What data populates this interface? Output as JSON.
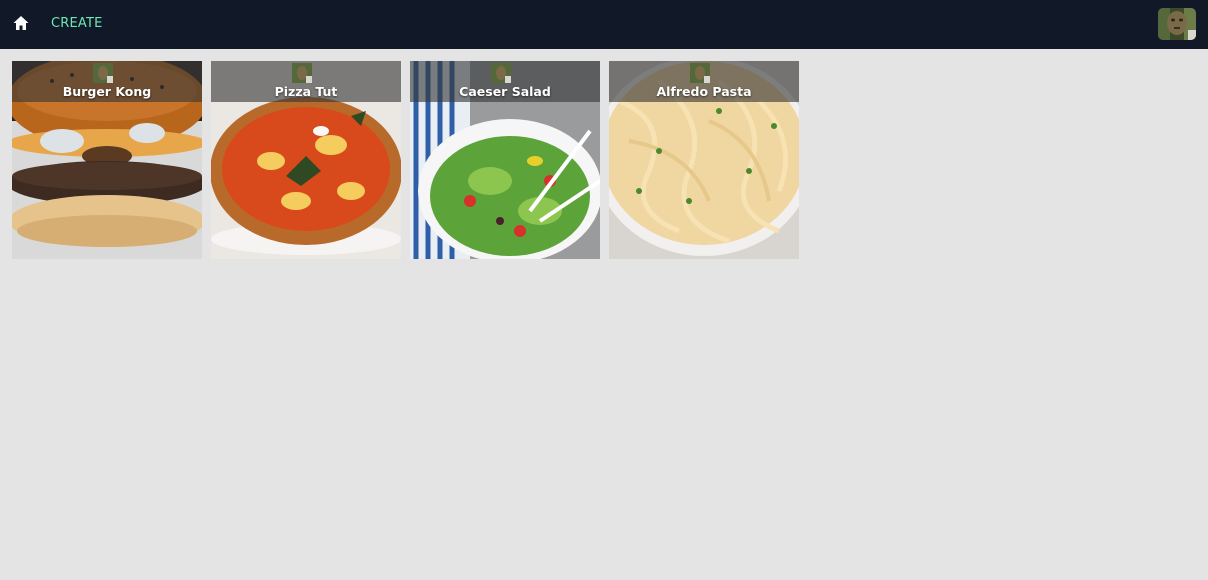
{
  "nav": {
    "home_icon": "home-icon",
    "create_label": "CREATE",
    "accent_color": "#6ee7b7",
    "background_color": "#111827"
  },
  "recipes": [
    {
      "title": "Burger Kong",
      "image": "burger-photo"
    },
    {
      "title": "Pizza Tut",
      "image": "pizza-photo"
    },
    {
      "title": "Caeser Salad",
      "image": "salad-photo"
    },
    {
      "title": "Alfredo Pasta",
      "image": "pasta-photo"
    }
  ]
}
